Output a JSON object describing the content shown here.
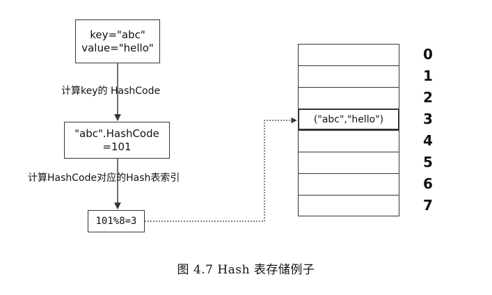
{
  "nodes": {
    "key_line1": "key=\"abc\"",
    "key_line2": "value=\"hello\"",
    "hash_line1": "\"abc\".HashCode",
    "hash_line2": "=101",
    "mod": "101%8=3"
  },
  "labels": {
    "step1": "计算key的 HashCode",
    "step2": "计算HashCode对应的Hash表索引"
  },
  "table": {
    "rows": [
      "",
      "",
      "",
      "(\"abc\",\"hello\")",
      "",
      "",
      "",
      ""
    ],
    "indices": [
      "0",
      "1",
      "2",
      "3",
      "4",
      "5",
      "6",
      "7"
    ]
  },
  "caption": "图 4.7    Hash 表存储例子"
}
